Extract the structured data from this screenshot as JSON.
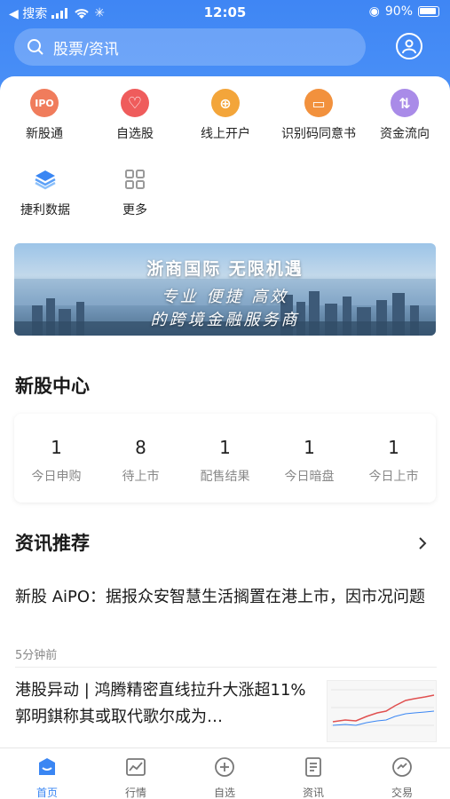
{
  "status_bar": {
    "back_label": "◀ 搜索",
    "time": "12:05",
    "battery": "90%"
  },
  "search": {
    "placeholder": "股票/资讯"
  },
  "quick_menu": [
    {
      "label": "新股通",
      "icon": "ipo-icon",
      "color": "#f07c5c",
      "glyph": "IPO"
    },
    {
      "label": "自选股",
      "icon": "heart-icon",
      "color": "#ef5c5c",
      "glyph": "♡"
    },
    {
      "label": "线上开户",
      "icon": "account-icon",
      "color": "#f3a53a",
      "glyph": "⊕"
    },
    {
      "label": "识别码同意书",
      "icon": "document-icon",
      "color": "#f2913d",
      "glyph": "▭"
    },
    {
      "label": "资金流向",
      "icon": "fund-flow-icon",
      "color": "#a98be8",
      "glyph": "⇅"
    },
    {
      "label": "捷利数据",
      "icon": "layers-icon",
      "color": "#3a86f3",
      "glyph": ""
    },
    {
      "label": "更多",
      "icon": "grid-icon",
      "color": "#999999",
      "glyph": ""
    }
  ],
  "banner": {
    "title": "浙商国际  无限机遇",
    "line1": "专业  便捷  高效",
    "line2": "的跨境金融服务商"
  },
  "ipo_center": {
    "title": "新股中心",
    "items": [
      {
        "value": "1",
        "label": "今日申购"
      },
      {
        "value": "8",
        "label": "待上市"
      },
      {
        "value": "1",
        "label": "配售结果"
      },
      {
        "value": "1",
        "label": "今日暗盘"
      },
      {
        "value": "1",
        "label": "今日上市"
      }
    ]
  },
  "news": {
    "title": "资讯推荐",
    "items": [
      {
        "headline": "新股 AiPO：据报众安智慧生活搁置在港上市，因市况问题",
        "time": "5分钟前"
      },
      {
        "headline": "港股异动 | 鸿腾精密直线拉升大涨超11% 郭明錤称其或取代歌尔成为…",
        "time": ""
      }
    ]
  },
  "tabbar": [
    {
      "label": "首页",
      "icon": "home-icon",
      "active": true
    },
    {
      "label": "行情",
      "icon": "chart-icon",
      "active": false
    },
    {
      "label": "自选",
      "icon": "add-circle-icon",
      "active": false
    },
    {
      "label": "资讯",
      "icon": "news-icon",
      "active": false
    },
    {
      "label": "交易",
      "icon": "trade-icon",
      "active": false
    }
  ],
  "colors": {
    "brand": "#3a86f3",
    "accent": "#4a90f7"
  }
}
